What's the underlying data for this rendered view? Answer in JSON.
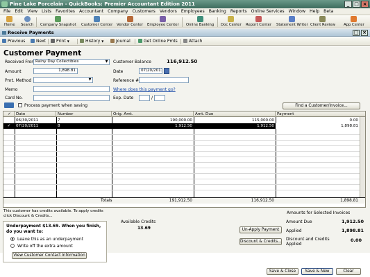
{
  "window": {
    "title": "Pine Lake Porcelain - QuickBooks: Premier Accountant Edition 2011",
    "min": "_",
    "max": "□",
    "close": "×"
  },
  "menu": [
    "File",
    "Edit",
    "View",
    "Lists",
    "Favorites",
    "Accountant",
    "Company",
    "Customers",
    "Vendors",
    "Employees",
    "Banking",
    "Reports",
    "Online Services",
    "Window",
    "Help",
    "Beta"
  ],
  "iconbar": [
    {
      "label": "Home",
      "icon": "home-icon",
      "color": "#d9a441"
    },
    {
      "label": "Search",
      "icon": "search-icon",
      "color": "#6a8fbf"
    },
    {
      "label": "Company Snapshot",
      "icon": "snapshot-icon",
      "color": "#5b9c5b"
    },
    {
      "label": "Customer Center",
      "icon": "customer-center-icon",
      "color": "#4f83b8"
    },
    {
      "label": "Vendor Center",
      "icon": "vendor-center-icon",
      "color": "#b86b3a"
    },
    {
      "label": "Employee Center",
      "icon": "employee-center-icon",
      "color": "#7a5fa8"
    },
    {
      "label": "Online Banking",
      "icon": "online-banking-icon",
      "color": "#3e8f7a"
    },
    {
      "label": "Doc Center",
      "icon": "doc-center-icon",
      "color": "#c9b24a"
    },
    {
      "label": "Report Center",
      "icon": "report-center-icon",
      "color": "#c75a5a"
    },
    {
      "label": "Statement Writer",
      "icon": "statement-writer-icon",
      "color": "#5a7fc7"
    },
    {
      "label": "Client Review",
      "icon": "client-review-icon",
      "color": "#8a8a5a"
    },
    {
      "label": "App Center",
      "icon": "app-center-icon",
      "color": "#e07a30"
    }
  ],
  "panel_title": "Receive Payments",
  "toolbar": {
    "previous": "Previous",
    "next": "Next",
    "print": "Print",
    "history": "History",
    "journal": "Journal",
    "get_online_pmts": "Get Online Pmts",
    "attach": "Attach",
    "dd": "▼"
  },
  "form": {
    "heading": "Customer Payment",
    "received_from_label": "Received From",
    "received_from": "Rainy Day Collectibles",
    "customer_balance_label": "Customer Balance",
    "customer_balance": "116,912.50",
    "amount_label": "Amount",
    "amount": "1,898.81",
    "date_label": "Date",
    "date": "07/20/2011",
    "pmt_method_label": "Pmt. Method",
    "pmt_method": "",
    "reference_label": "Reference #",
    "reference": "",
    "memo_label": "Memo",
    "memo": "",
    "where_link": "Where does this payment go?",
    "card_no_label": "Card No.",
    "card_no": "",
    "exp_date_label": "Exp. Date",
    "exp_month": "",
    "exp_year": "",
    "process_label": "Process  payment when saving",
    "find_button": "Find a Customer/Invoice..."
  },
  "grid": {
    "columns": [
      "✓",
      "Date",
      "Number",
      "Orig. Amt.",
      "Amt. Due",
      "Payment"
    ],
    "rows": [
      {
        "check": "",
        "date": "06/30/2011",
        "number": "7",
        "orig": "190,000.00",
        "due": "115,000.00",
        "payment": "0.00",
        "selected": false
      },
      {
        "check": "✓",
        "date": "07/20/2011",
        "number": "8",
        "orig": "1,912.50",
        "due": "1,912.50",
        "payment": "1,898.81",
        "selected": true
      }
    ],
    "totals_label": "Totals",
    "total_orig": "191,912.50",
    "total_due": "116,912.50",
    "total_payment": "1,898.81"
  },
  "bottom": {
    "credits_note": "This customer has credits available. To apply credits click Discount & Credits...",
    "underpayment_msg": "Underpayment $13.69. When you finish, do you want to:",
    "option_leave": "Leave this as an underpayment",
    "option_write_off": "Write off the extra amount",
    "view_contact_button": "View Customer Contact Information",
    "available_credits_label": "Available Credits",
    "available_credits": "13.69",
    "unapply_button": "Un-Apply Payment",
    "discount_button": "Discount & Credits...",
    "amounts_header": "Amounts for Selected Invoices",
    "amount_due_label": "Amount Due",
    "amount_due": "1,912.50",
    "applied_label": "Applied",
    "applied": "1,898.81",
    "discount_label": "Discount and Credits Applied",
    "discount_value": "0.00",
    "save_close": "Save & Close",
    "save_new": "Save & New",
    "clear": "Clear"
  }
}
